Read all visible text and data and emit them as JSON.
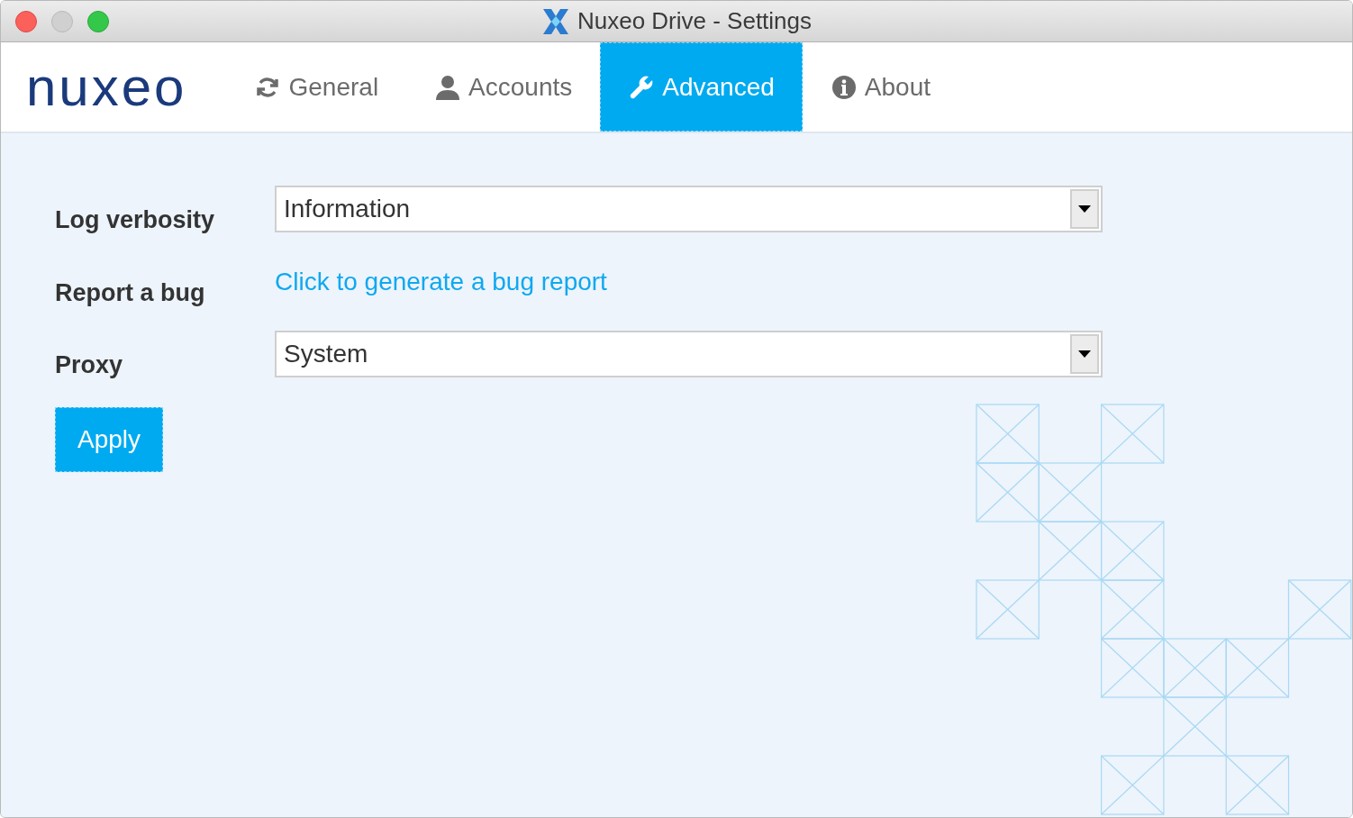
{
  "window": {
    "title": "Nuxeo Drive - Settings"
  },
  "logo": {
    "text": "nuxeo"
  },
  "tabs": [
    {
      "label": "General",
      "selected": false
    },
    {
      "label": "Accounts",
      "selected": false
    },
    {
      "label": "Advanced",
      "selected": true
    },
    {
      "label": "About",
      "selected": false
    }
  ],
  "settings": [
    {
      "kind": "select",
      "label": "Log verbosity",
      "value": "Information"
    },
    {
      "kind": "link",
      "label": "Report a bug",
      "value": "Click to generate a bug report"
    },
    {
      "kind": "select",
      "label": "Proxy",
      "value": "System"
    }
  ],
  "apply_button": "Apply"
}
